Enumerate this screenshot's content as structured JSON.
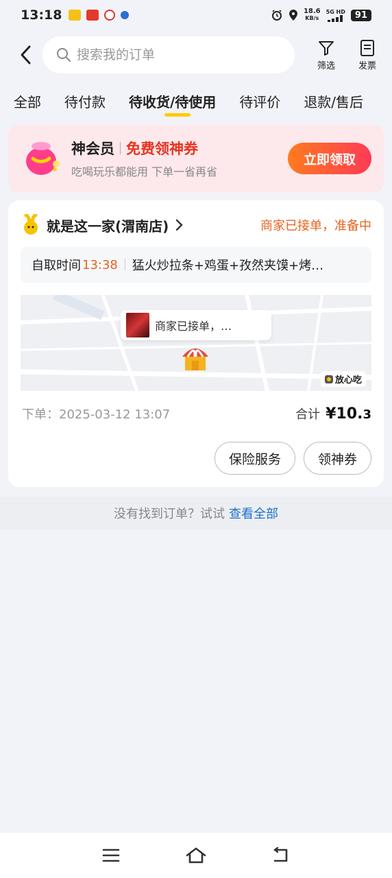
{
  "status_bar": {
    "time": "13:18",
    "net_speed_value": "18.6",
    "net_speed_unit": "KB/s",
    "network": "5G HD",
    "battery": "91"
  },
  "header": {
    "search_placeholder": "搜索我的订单",
    "filter_label": "筛选",
    "invoice_label": "发票"
  },
  "tabs": [
    {
      "label": "全部"
    },
    {
      "label": "待付款"
    },
    {
      "label": "待收货/待使用"
    },
    {
      "label": "待评价"
    },
    {
      "label": "退款/售后"
    }
  ],
  "active_tab": "待收货/待使用",
  "member_banner": {
    "title": "神会员",
    "title_highlight": "免费领神券",
    "subtitle": "吃喝玩乐都能用 下单一省再省",
    "button_label": "立即领取"
  },
  "order": {
    "store_name": "就是这一家(渭南店)",
    "status": "商家已接单，准备中",
    "pickup_label": "自取时间",
    "pickup_time": "13:38",
    "items": "猛火炒拉条+鸡蛋+孜然夹馍+烤…",
    "map_tooltip": "商家已接单，…",
    "safe_badge": "放心吃",
    "order_date": "下单：2025-03-12 13:07",
    "total_label": "合计",
    "total_currency": "¥",
    "total_int": "10.",
    "total_dec": "3",
    "buttons": {
      "insurance": "保险服务",
      "coupon": "领神券"
    }
  },
  "not_found": {
    "text": "没有找到订单？试试",
    "link": "查看全部"
  },
  "colors": {
    "accent_orange": "#e8631e",
    "link_blue": "#1d72c8",
    "tab_underline": "#ffcc00",
    "banner_bg": "#fde8ec"
  }
}
